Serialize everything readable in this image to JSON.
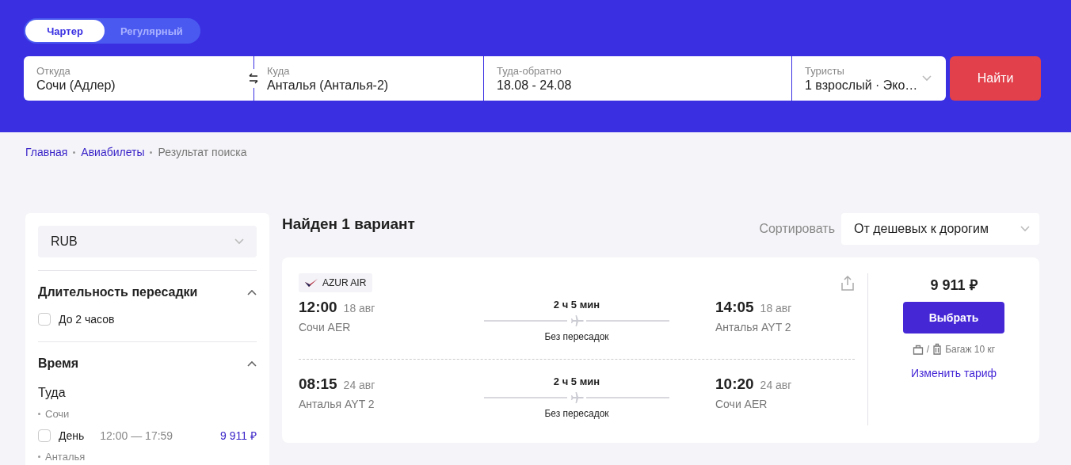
{
  "tabs": [
    {
      "label": "Чартер",
      "selected": true
    },
    {
      "label": "Регулярный",
      "selected": false
    }
  ],
  "search_fields": [
    {
      "label": "Откуда",
      "value": "Сочи (Адлер)",
      "kind": "text"
    },
    {
      "label": "Куда",
      "value": "Анталья (Анталья-2)",
      "kind": "text"
    },
    {
      "label": "Туда-обратно",
      "value": "18.08 - 24.08",
      "kind": "text"
    },
    {
      "label": "Туристы",
      "value": "1 взрослый · Эко…",
      "kind": "dropdown"
    }
  ],
  "search_button": "Найти",
  "breadcrumbs": [
    {
      "label": "Главная",
      "kind": "link"
    },
    {
      "label": "Авиабилеты",
      "kind": "link"
    },
    {
      "label": "Результат поиска",
      "kind": "current"
    }
  ],
  "filters": {
    "currency": "RUB",
    "sections": [
      {
        "title": "Длительность пересадки",
        "expanded": true,
        "options": [
          {
            "label": "До 2 часов",
            "checked": false
          }
        ]
      },
      {
        "title": "Время",
        "expanded": true,
        "subtitle": "Туда",
        "groups": [
          {
            "city": "Сочи",
            "options": [
              {
                "label": "День",
                "range": "12:00 — 17:59",
                "price": "9 911 ₽",
                "checked": false
              }
            ]
          },
          {
            "city": "Анталья"
          }
        ]
      }
    ]
  },
  "results": {
    "heading": "Найден 1 вариант",
    "sort_label": "Сортировать",
    "sort_value": "От дешевых к дорогим",
    "offers": [
      {
        "airline": "AZUR AIR",
        "price": "9 911 ₽",
        "select_button": "Выбрать",
        "baggage_separator": "/",
        "baggage": "Багаж 10 кг",
        "change_tariff": "Изменить тариф",
        "legs": [
          {
            "dep_time": "12:00",
            "dep_date": "18 авг",
            "dep_airport": "Сочи AER",
            "duration": "2 ч 5 мин",
            "stops": "Без пересадок",
            "arr_time": "14:05",
            "arr_date": "18 авг",
            "arr_airport": "Анталья AYT 2"
          },
          {
            "dep_time": "08:15",
            "dep_date": "24 авг",
            "dep_airport": "Анталья AYT 2",
            "duration": "2 ч 5 мин",
            "stops": "Без пересадок",
            "arr_time": "10:20",
            "arr_date": "24 авг",
            "arr_airport": "Сочи AER"
          }
        ]
      }
    ]
  }
}
